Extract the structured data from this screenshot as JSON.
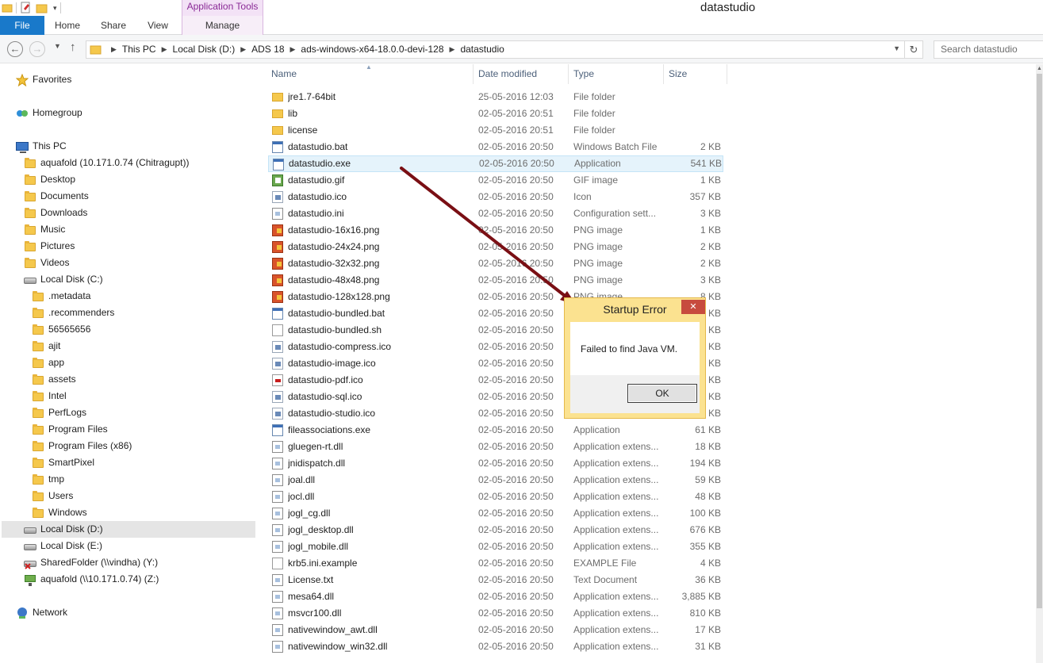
{
  "window": {
    "title": "datastudio"
  },
  "ribbon": {
    "context_group": "Application Tools",
    "tabs": [
      "File",
      "Home",
      "Share",
      "View",
      "Manage"
    ]
  },
  "address": {
    "crumbs": [
      "This PC",
      "Local Disk (D:)",
      "ADS 18",
      "ads-windows-x64-18.0.0-devi-128",
      "datastudio"
    ],
    "search_placeholder": "Search datastudio"
  },
  "columns": {
    "name": "Name",
    "date": "Date modified",
    "type": "Type",
    "size": "Size"
  },
  "nav": {
    "favorites": "Favorites",
    "homegroup": "Homegroup",
    "this_pc": "This PC",
    "pc_items": [
      "aquafold (10.171.0.74 (Chitragupt))",
      "Desktop",
      "Documents",
      "Downloads",
      "Music",
      "Pictures",
      "Videos",
      "Local Disk (C:)"
    ],
    "c_items": [
      ".metadata",
      ".recommenders",
      "56565656",
      "ajit",
      "app",
      "assets",
      "Intel",
      "PerfLogs",
      "Program Files",
      "Program Files (x86)",
      "SmartPixel",
      "tmp",
      "Users",
      "Windows"
    ],
    "drives": [
      "Local Disk (D:)",
      "Local Disk (E:)",
      "SharedFolder (\\\\vindha) (Y:)",
      "aquafold (\\\\10.171.0.74) (Z:)"
    ],
    "network": "Network"
  },
  "files": [
    {
      "icon": "folder-icon",
      "name": "jre1.7-64bit",
      "date": "25-05-2016 12:03",
      "type": "File folder",
      "size": ""
    },
    {
      "icon": "folder-icon",
      "name": "lib",
      "date": "02-05-2016 20:51",
      "type": "File folder",
      "size": ""
    },
    {
      "icon": "folder-icon",
      "name": "license",
      "date": "02-05-2016 20:51",
      "type": "File folder",
      "size": ""
    },
    {
      "icon": "batch-file-icon",
      "name": "datastudio.bat",
      "date": "02-05-2016 20:50",
      "type": "Windows Batch File",
      "size": "2 KB"
    },
    {
      "icon": "application-icon",
      "name": "datastudio.exe",
      "date": "02-05-2016 20:50",
      "type": "Application",
      "size": "541 KB"
    },
    {
      "icon": "gif-image-icon",
      "name": "datastudio.gif",
      "date": "02-05-2016 20:50",
      "type": "GIF image",
      "size": "1 KB"
    },
    {
      "icon": "ico-file-icon",
      "name": "datastudio.ico",
      "date": "02-05-2016 20:50",
      "type": "Icon",
      "size": "357 KB"
    },
    {
      "icon": "config-file-icon",
      "name": "datastudio.ini",
      "date": "02-05-2016 20:50",
      "type": "Configuration sett...",
      "size": "3 KB"
    },
    {
      "icon": "png-image-icon",
      "name": "datastudio-16x16.png",
      "date": "02-05-2016 20:50",
      "type": "PNG image",
      "size": "1 KB"
    },
    {
      "icon": "png-image-icon",
      "name": "datastudio-24x24.png",
      "date": "02-05-2016 20:50",
      "type": "PNG image",
      "size": "2 KB"
    },
    {
      "icon": "png-image-icon",
      "name": "datastudio-32x32.png",
      "date": "02-05-2016 20:50",
      "type": "PNG image",
      "size": "2 KB"
    },
    {
      "icon": "png-image-icon",
      "name": "datastudio-48x48.png",
      "date": "02-05-2016 20:50",
      "type": "PNG image",
      "size": "3 KB"
    },
    {
      "icon": "png-image-icon",
      "name": "datastudio-128x128.png",
      "date": "02-05-2016 20:50",
      "type": "PNG image",
      "size": "8 KB"
    },
    {
      "icon": "batch-file-icon",
      "name": "datastudio-bundled.bat",
      "date": "02-05-2016 20:50",
      "type": "",
      "size": "KB"
    },
    {
      "icon": "blank-file-icon",
      "name": "datastudio-bundled.sh",
      "date": "02-05-2016 20:50",
      "type": "",
      "size": "KB"
    },
    {
      "icon": "ico-file-icon",
      "name": "datastudio-compress.ico",
      "date": "02-05-2016 20:50",
      "type": "",
      "size": "KB"
    },
    {
      "icon": "ico-file-icon",
      "name": "datastudio-image.ico",
      "date": "02-05-2016 20:50",
      "type": "",
      "size": "KB"
    },
    {
      "icon": "pdf-ico-icon",
      "name": "datastudio-pdf.ico",
      "date": "02-05-2016 20:50",
      "type": "",
      "size": "KB"
    },
    {
      "icon": "ico-file-icon",
      "name": "datastudio-sql.ico",
      "date": "02-05-2016 20:50",
      "type": "",
      "size": "KB"
    },
    {
      "icon": "ico-file-icon",
      "name": "datastudio-studio.ico",
      "date": "02-05-2016 20:50",
      "type": "",
      "size": "KB"
    },
    {
      "icon": "application-icon",
      "name": "fileassociations.exe",
      "date": "02-05-2016 20:50",
      "type": "Application",
      "size": "61 KB"
    },
    {
      "icon": "dll-file-icon",
      "name": "gluegen-rt.dll",
      "date": "02-05-2016 20:50",
      "type": "Application extens...",
      "size": "18 KB"
    },
    {
      "icon": "dll-file-icon",
      "name": "jnidispatch.dll",
      "date": "02-05-2016 20:50",
      "type": "Application extens...",
      "size": "194 KB"
    },
    {
      "icon": "dll-file-icon",
      "name": "joal.dll",
      "date": "02-05-2016 20:50",
      "type": "Application extens...",
      "size": "59 KB"
    },
    {
      "icon": "dll-file-icon",
      "name": "jocl.dll",
      "date": "02-05-2016 20:50",
      "type": "Application extens...",
      "size": "48 KB"
    },
    {
      "icon": "dll-file-icon",
      "name": "jogl_cg.dll",
      "date": "02-05-2016 20:50",
      "type": "Application extens...",
      "size": "100 KB"
    },
    {
      "icon": "dll-file-icon",
      "name": "jogl_desktop.dll",
      "date": "02-05-2016 20:50",
      "type": "Application extens...",
      "size": "676 KB"
    },
    {
      "icon": "dll-file-icon",
      "name": "jogl_mobile.dll",
      "date": "02-05-2016 20:50",
      "type": "Application extens...",
      "size": "355 KB"
    },
    {
      "icon": "blank-file-icon",
      "name": "krb5.ini.example",
      "date": "02-05-2016 20:50",
      "type": "EXAMPLE File",
      "size": "4 KB"
    },
    {
      "icon": "text-document-icon",
      "name": "License.txt",
      "date": "02-05-2016 20:50",
      "type": "Text Document",
      "size": "36 KB"
    },
    {
      "icon": "dll-file-icon",
      "name": "mesa64.dll",
      "date": "02-05-2016 20:50",
      "type": "Application extens...",
      "size": "3,885 KB"
    },
    {
      "icon": "dll-file-icon",
      "name": "msvcr100.dll",
      "date": "02-05-2016 20:50",
      "type": "Application extens...",
      "size": "810 KB"
    },
    {
      "icon": "dll-file-icon",
      "name": "nativewindow_awt.dll",
      "date": "02-05-2016 20:50",
      "type": "Application extens...",
      "size": "17 KB"
    },
    {
      "icon": "dll-file-icon",
      "name": "nativewindow_win32.dll",
      "date": "02-05-2016 20:50",
      "type": "Application extens...",
      "size": "31 KB"
    }
  ],
  "dialog": {
    "title": "Startup Error",
    "message": "Failed to find Java VM.",
    "ok_label": "OK",
    "close_glyph": "✕"
  },
  "colors": {
    "accent": "#1979ca",
    "arrow": "#7a0f14",
    "dialog_frame": "#fbe290"
  }
}
